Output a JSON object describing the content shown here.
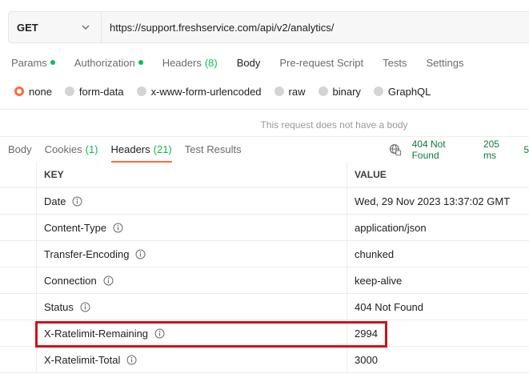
{
  "request": {
    "method": "GET",
    "url": "https://support.freshservice.com/api/v2/analytics/"
  },
  "request_tabs": [
    {
      "label": "Params",
      "dot": true,
      "count": ""
    },
    {
      "label": "Authorization",
      "dot": true,
      "count": ""
    },
    {
      "label": "Headers",
      "dot": false,
      "count": "(8)"
    },
    {
      "label": "Body",
      "dot": false,
      "count": ""
    },
    {
      "label": "Pre-request Script",
      "dot": false,
      "count": ""
    },
    {
      "label": "Tests",
      "dot": false,
      "count": ""
    },
    {
      "label": "Settings",
      "dot": false,
      "count": ""
    }
  ],
  "body_types": [
    "none",
    "form-data",
    "x-www-form-urlencoded",
    "raw",
    "binary",
    "GraphQL"
  ],
  "selected_body_type": "none",
  "no_body_message": "This request does not have a body",
  "response_tabs": [
    {
      "label": "Body",
      "count": ""
    },
    {
      "label": "Cookies",
      "count": "(1)"
    },
    {
      "label": "Headers",
      "count": "(21)"
    },
    {
      "label": "Test Results",
      "count": ""
    }
  ],
  "response": {
    "status": "404 Not Found",
    "time": "205 ms",
    "size": "5"
  },
  "table": {
    "key_header": "KEY",
    "value_header": "VALUE",
    "rows": [
      {
        "key": "Date",
        "value": "Wed, 29 Nov 2023 13:37:02 GMT"
      },
      {
        "key": "Content-Type",
        "value": "application/json"
      },
      {
        "key": "Transfer-Encoding",
        "value": "chunked"
      },
      {
        "key": "Connection",
        "value": "keep-alive"
      },
      {
        "key": "Status",
        "value": "404 Not Found"
      },
      {
        "key": "X-Ratelimit-Remaining",
        "value": "2994"
      },
      {
        "key": "X-Ratelimit-Total",
        "value": "3000"
      }
    ]
  },
  "colors": {
    "accent": "#ff6c37",
    "success": "#0cbb52",
    "highlight_border": "#d0121b"
  },
  "icons": {
    "method_dropdown": "chevron-down-icon",
    "network": "globe-icon",
    "info": "info-icon"
  }
}
